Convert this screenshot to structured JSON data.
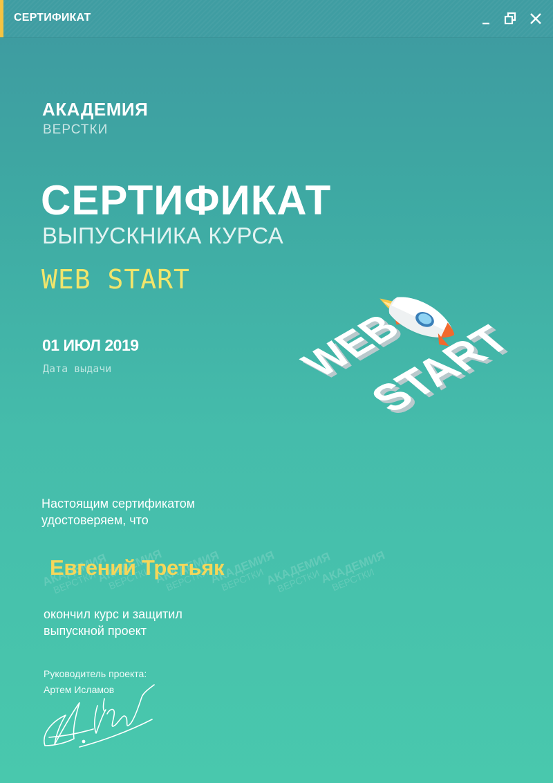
{
  "window": {
    "title": "СЕРТИФИКАТ",
    "accent_color": "#f5c443",
    "buttons": {
      "minimize": "minimize-icon",
      "restore": "restore-icon",
      "close": "close-icon"
    }
  },
  "logo": {
    "main": "АКАДЕМИЯ",
    "sub": "ВЕРСТКИ"
  },
  "certificate": {
    "title": "СЕРТИФИКАТ",
    "subtitle": "ВЫПУСКНИКА КУРСА",
    "course": "WEB START",
    "course_color": "#f2e56b",
    "issue_date": "01 ИЮЛ 2019",
    "issue_date_label": "Дата выдачи"
  },
  "illustration": {
    "line1": "WEB",
    "line2": "START",
    "icon": "rocket-icon"
  },
  "body": {
    "intro_line1": "Настоящим сертификатом",
    "intro_line2": "удостоверяем, что",
    "recipient": "Евгений Третьяк",
    "recipient_color": "#f5d75a",
    "completion_line1": "окончил курс и защитил",
    "completion_line2": "выпускной проект"
  },
  "watermark": {
    "main": "АКАДЕМИЯ",
    "sub": "ВЕРСТКИ"
  },
  "supervisor": {
    "label": "Руководитель проекта:",
    "name": "Артем Исламов"
  }
}
